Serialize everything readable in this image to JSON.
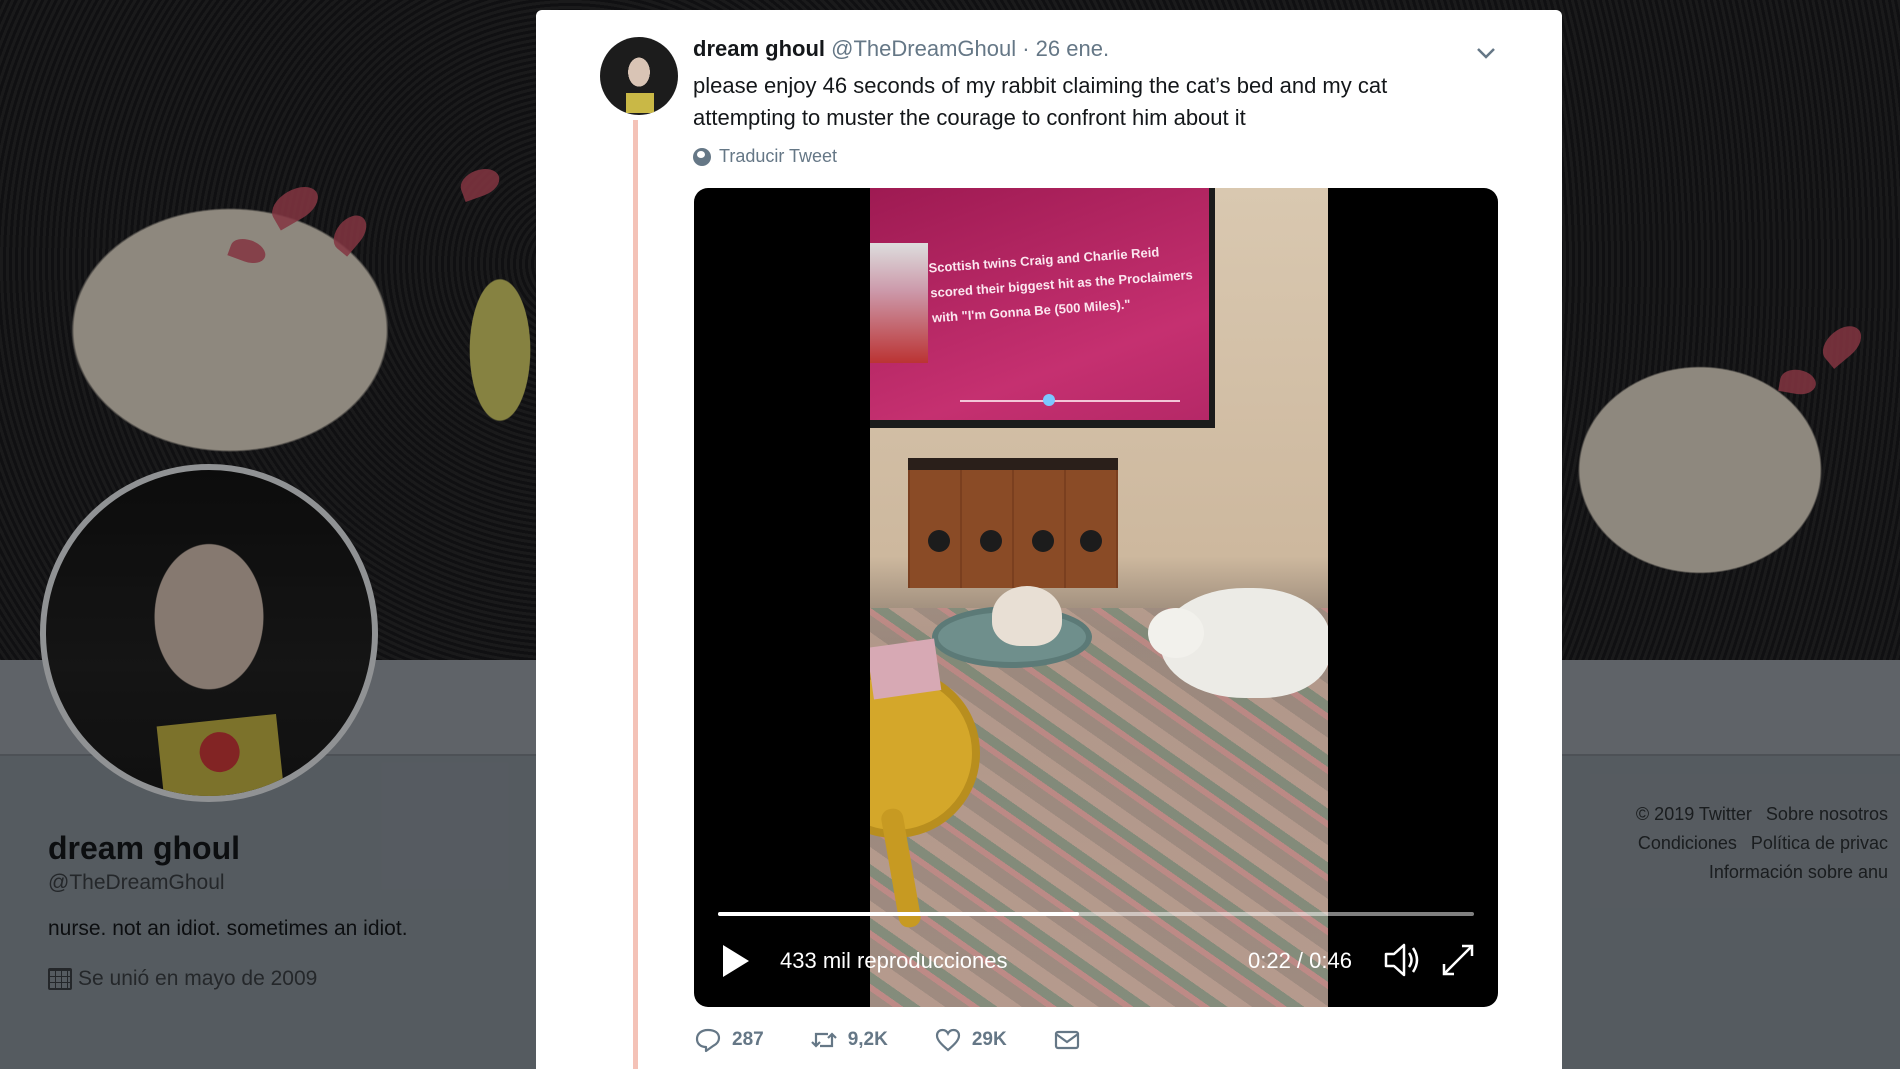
{
  "profile": {
    "name": "dream ghoul",
    "handle": "@TheDreamGhoul",
    "bio": "nurse. not an idiot. sometimes an idiot.",
    "joined": "Se unió en mayo de 2009"
  },
  "footer": {
    "links": [
      "© 2019 Twitter",
      "Sobre nosotros",
      "Condiciones",
      "Política de privac",
      "Información sobre anu"
    ]
  },
  "tweet": {
    "name": "dream ghoul",
    "handle": "@TheDreamGhoul",
    "date": "· 26 ene.",
    "text": "please enjoy 46 seconds of my rabbit claiming the cat’s bed and my cat attempting to muster the courage to confront him about it",
    "translate": "Traducir Tweet",
    "video": {
      "views": "433 mil reproducciones",
      "time": "0:22 / 0:46",
      "progress": 0.478,
      "tv_text": "Scottish twins Craig and Charlie Reid scored their biggest hit as the Proclaimers with \"I'm Gonna Be (500 Miles).\""
    },
    "stats": {
      "replies": "287",
      "retweets": "9,2K",
      "likes": "29K"
    }
  },
  "icons": [
    "chevron-down-icon",
    "globe-icon",
    "play-icon",
    "volume-icon",
    "fullscreen-icon",
    "reply-icon",
    "retweet-icon",
    "like-icon",
    "dm-icon",
    "calendar-icon"
  ]
}
